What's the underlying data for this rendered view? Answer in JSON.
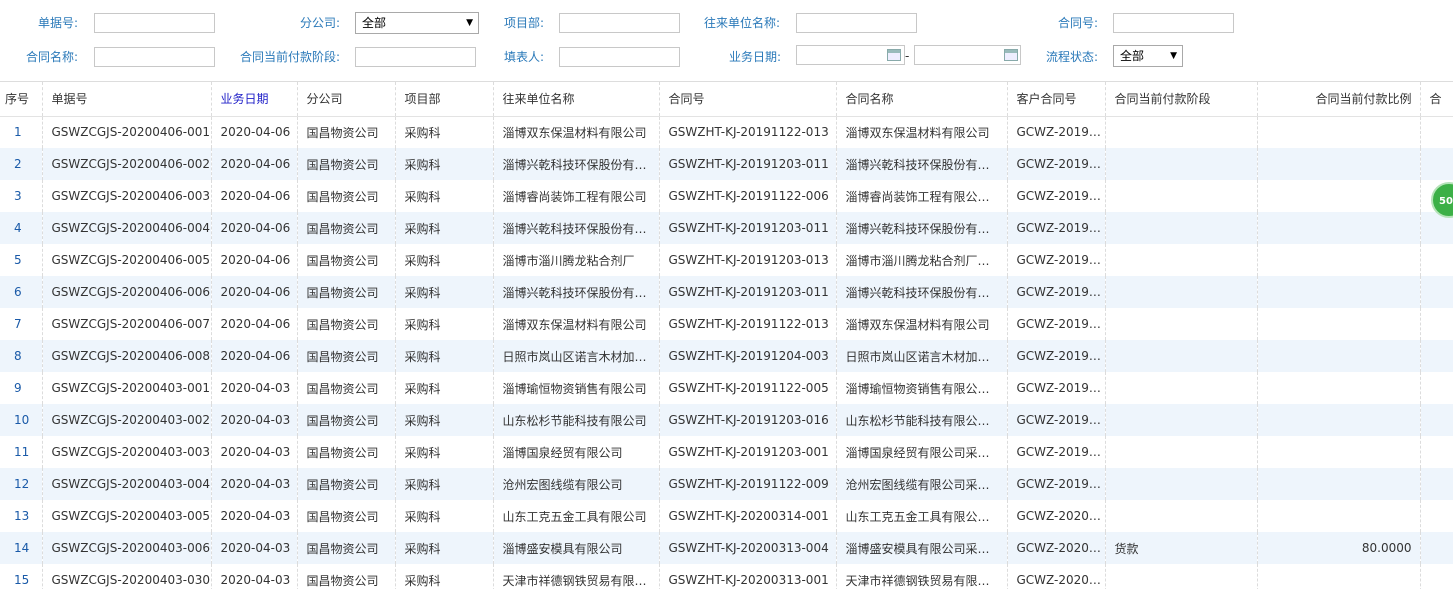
{
  "filters": {
    "bill_no_label": "单据号:",
    "branch_label": "分公司:",
    "branch_value": "全部",
    "project_label": "项目部:",
    "partner_label": "往来单位名称:",
    "contract_no_label": "合同号:",
    "contract_name_label": "合同名称:",
    "pay_stage_label": "合同当前付款阶段:",
    "filler_label": "填表人:",
    "biz_date_label": "业务日期:",
    "date_sep": "-",
    "flow_label": "流程状态:",
    "flow_value": "全部"
  },
  "float_badge": "50",
  "columns": [
    "序号",
    "单据号",
    "业务日期",
    "分公司",
    "项目部",
    "往来单位名称",
    "合同号",
    "合同名称",
    "客户合同号",
    "合同当前付款阶段",
    "合同当前付款比例",
    "合"
  ],
  "rows": [
    [
      "1",
      "GSWZCGJS-20200406-001",
      "2020-04-06",
      "国昌物资公司",
      "采购科",
      "淄博双东保温材料有限公司",
      "GSWZHT-KJ-20191122-013",
      "淄博双东保温材料有限公司",
      "GCWZ-2019…",
      "",
      ""
    ],
    [
      "2",
      "GSWZCGJS-20200406-002",
      "2020-04-06",
      "国昌物资公司",
      "采购科",
      "淄博兴乾科技环保股份有…",
      "GSWZHT-KJ-20191203-011",
      "淄博兴乾科技环保股份有…",
      "GCWZ-2019…",
      "",
      ""
    ],
    [
      "3",
      "GSWZCGJS-20200406-003",
      "2020-04-06",
      "国昌物资公司",
      "采购科",
      "淄博睿尚装饰工程有限公司",
      "GSWZHT-KJ-20191122-006",
      "淄博睿尚装饰工程有限公…",
      "GCWZ-2019…",
      "",
      ""
    ],
    [
      "4",
      "GSWZCGJS-20200406-004",
      "2020-04-06",
      "国昌物资公司",
      "采购科",
      "淄博兴乾科技环保股份有…",
      "GSWZHT-KJ-20191203-011",
      "淄博兴乾科技环保股份有…",
      "GCWZ-2019…",
      "",
      ""
    ],
    [
      "5",
      "GSWZCGJS-20200406-005",
      "2020-04-06",
      "国昌物资公司",
      "采购科",
      "淄博市淄川腾龙粘合剂厂",
      "GSWZHT-KJ-20191203-013",
      "淄博市淄川腾龙粘合剂厂…",
      "GCWZ-2019…",
      "",
      ""
    ],
    [
      "6",
      "GSWZCGJS-20200406-006",
      "2020-04-06",
      "国昌物资公司",
      "采购科",
      "淄博兴乾科技环保股份有…",
      "GSWZHT-KJ-20191203-011",
      "淄博兴乾科技环保股份有…",
      "GCWZ-2019…",
      "",
      ""
    ],
    [
      "7",
      "GSWZCGJS-20200406-007",
      "2020-04-06",
      "国昌物资公司",
      "采购科",
      "淄博双东保温材料有限公司",
      "GSWZHT-KJ-20191122-013",
      "淄博双东保温材料有限公司",
      "GCWZ-2019…",
      "",
      ""
    ],
    [
      "8",
      "GSWZCGJS-20200406-008",
      "2020-04-06",
      "国昌物资公司",
      "采购科",
      "日照市岚山区诺言木材加…",
      "GSWZHT-KJ-20191204-003",
      "日照市岚山区诺言木材加…",
      "GCWZ-2019…",
      "",
      ""
    ],
    [
      "9",
      "GSWZCGJS-20200403-001",
      "2020-04-03",
      "国昌物资公司",
      "采购科",
      "淄博瑜恒物资销售有限公司",
      "GSWZHT-KJ-20191122-005",
      "淄博瑜恒物资销售有限公…",
      "GCWZ-2019…",
      "",
      ""
    ],
    [
      "10",
      "GSWZCGJS-20200403-002",
      "2020-04-03",
      "国昌物资公司",
      "采购科",
      "山东松杉节能科技有限公司",
      "GSWZHT-KJ-20191203-016",
      "山东松杉节能科技有限公…",
      "GCWZ-2019…",
      "",
      ""
    ],
    [
      "11",
      "GSWZCGJS-20200403-003",
      "2020-04-03",
      "国昌物资公司",
      "采购科",
      "淄博国泉经贸有限公司",
      "GSWZHT-KJ-20191203-001",
      "淄博国泉经贸有限公司采…",
      "GCWZ-2019…",
      "",
      ""
    ],
    [
      "12",
      "GSWZCGJS-20200403-004",
      "2020-04-03",
      "国昌物资公司",
      "采购科",
      "沧州宏图线缆有限公司",
      "GSWZHT-KJ-20191122-009",
      "沧州宏图线缆有限公司采…",
      "GCWZ-2019…",
      "",
      ""
    ],
    [
      "13",
      "GSWZCGJS-20200403-005",
      "2020-04-03",
      "国昌物资公司",
      "采购科",
      "山东工克五金工具有限公司",
      "GSWZHT-KJ-20200314-001",
      "山东工克五金工具有限公…",
      "GCWZ-2020…",
      "",
      ""
    ],
    [
      "14",
      "GSWZCGJS-20200403-006",
      "2020-04-03",
      "国昌物资公司",
      "采购科",
      "淄博盛安模具有限公司",
      "GSWZHT-KJ-20200313-004",
      "淄博盛安模具有限公司采…",
      "GCWZ-2020…",
      "货款",
      "80.0000"
    ],
    [
      "15",
      "GSWZCGJS-20200403-030",
      "2020-04-03",
      "国昌物资公司",
      "采购科",
      "天津市祥德钢铁贸易有限…",
      "GSWZHT-KJ-20200313-001",
      "天津市祥德钢铁贸易有限…",
      "GCWZ-2020…",
      "",
      ""
    ]
  ]
}
